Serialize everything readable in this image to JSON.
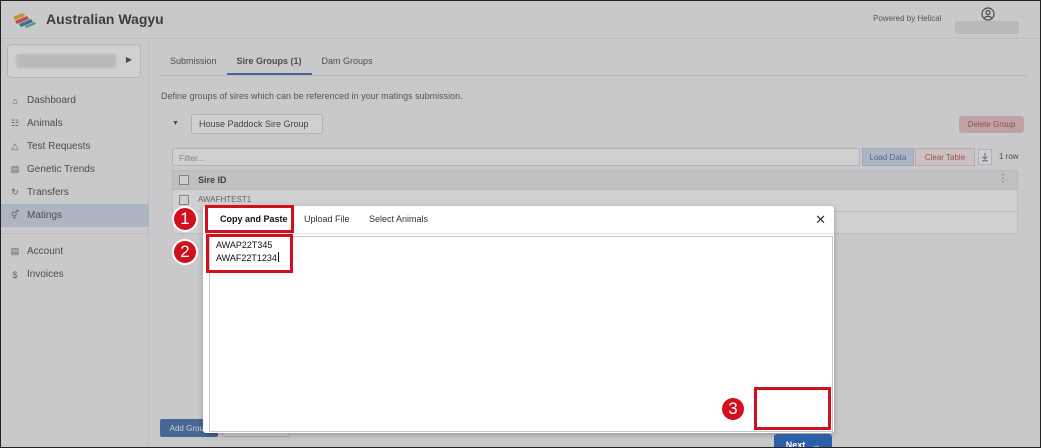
{
  "header": {
    "app_title": "Australian Wagyu",
    "powered_by": "Powered by Helical"
  },
  "sidebar": {
    "items": [
      {
        "label": "Dashboard",
        "icon": "home-icon"
      },
      {
        "label": "Animals",
        "icon": "animal-icon"
      },
      {
        "label": "Test Requests",
        "icon": "flask-icon"
      },
      {
        "label": "Genetic Trends",
        "icon": "bar-chart-icon"
      },
      {
        "label": "Transfers",
        "icon": "transfer-icon"
      },
      {
        "label": "Matings",
        "icon": "mating-icon",
        "active": true
      },
      {
        "label": "Account",
        "icon": "account-icon"
      },
      {
        "label": "Invoices",
        "icon": "dollar-icon"
      }
    ]
  },
  "main": {
    "tabs": [
      {
        "label": "Submission"
      },
      {
        "label": "Sire Groups (1)",
        "active": true
      },
      {
        "label": "Dam Groups"
      }
    ],
    "description": "Define groups of sires which can be referenced in your matings submission.",
    "group_name": "House Paddock Sire Group",
    "delete_group": "Delete Group",
    "filter_placeholder": "Filter...",
    "load_data": "Load Data",
    "clear_table": "Clear Table",
    "row_count": "1 row",
    "column_header": "Sire ID",
    "rows": [
      "AWAFHTEST1"
    ],
    "add_group": "Add Group"
  },
  "modal": {
    "tabs": [
      {
        "label": "Copy and Paste",
        "active": true
      },
      {
        "label": "Upload File"
      },
      {
        "label": "Select Animals"
      }
    ],
    "lines": [
      "AWAP22T345",
      "AWAF22T1234"
    ],
    "next_label": "Next",
    "close_icon": "close-icon"
  },
  "callouts": [
    "1",
    "2",
    "3"
  ],
  "colors": {
    "accent": "#2d5fa8",
    "callout": "#d10f1d",
    "danger": "#b03a48"
  }
}
